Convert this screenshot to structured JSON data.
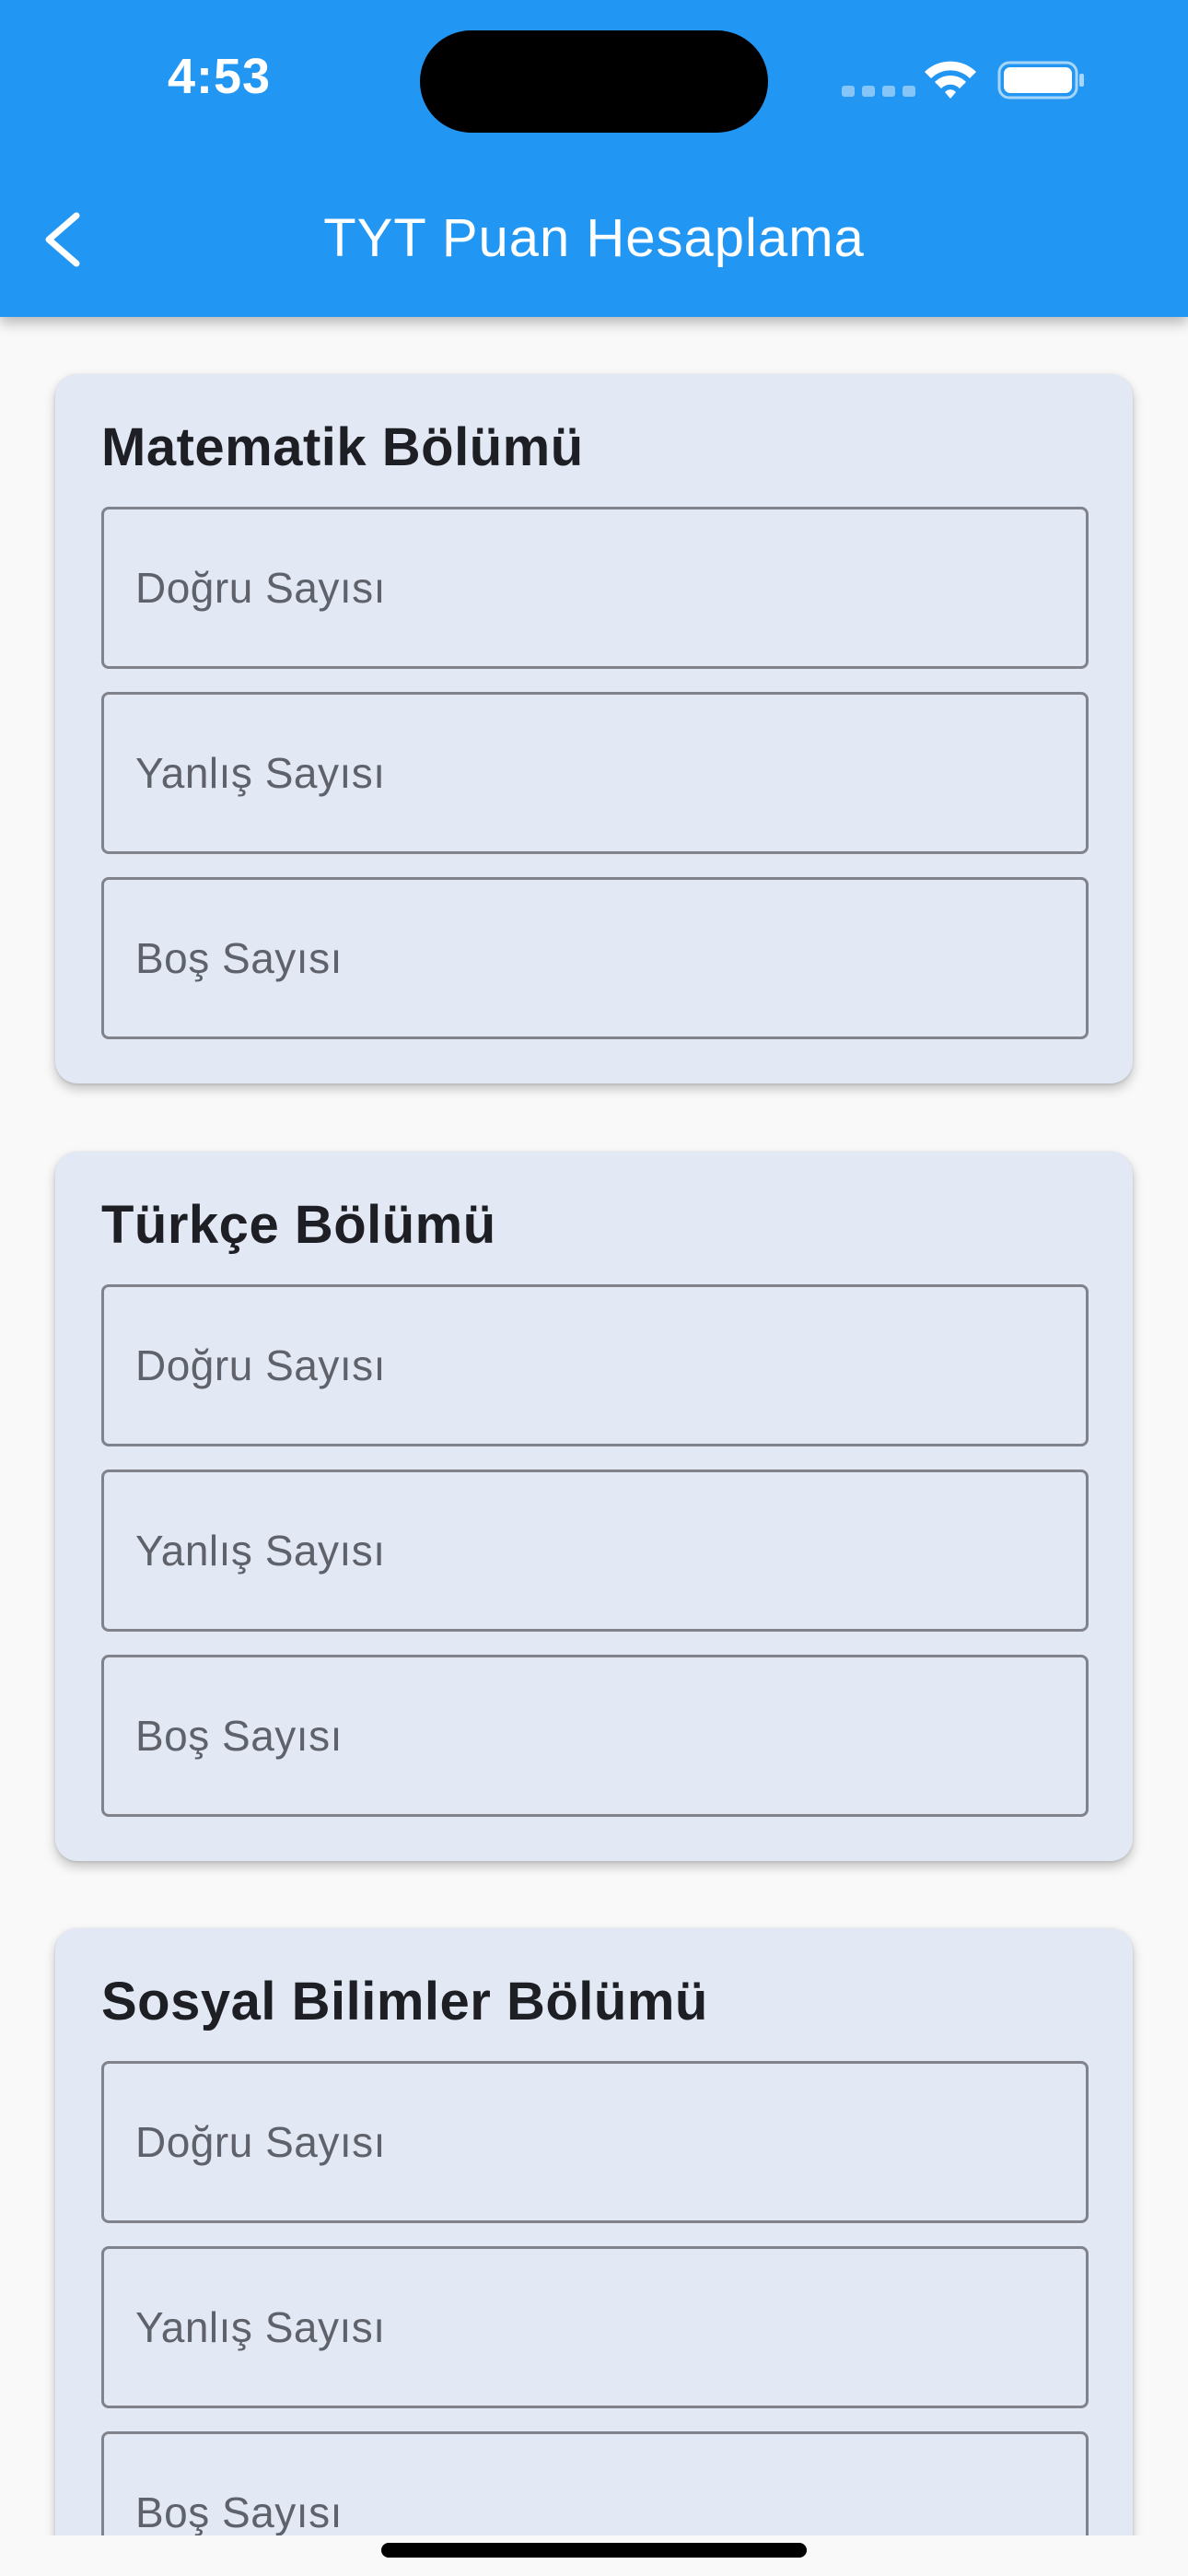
{
  "status_bar": {
    "time": "4:53",
    "icons": [
      "cellular-signal-icon",
      "wifi-icon",
      "battery-icon"
    ]
  },
  "app_bar": {
    "title": "TYT Puan Hesaplama",
    "back_icon": "chevron-left-icon",
    "background_color": "#2196f3"
  },
  "sections": [
    {
      "title": "Matematik Bölümü",
      "fields": [
        {
          "label": "Doğru Sayısı",
          "value": ""
        },
        {
          "label": "Yanlış Sayısı",
          "value": ""
        },
        {
          "label": "Boş Sayısı",
          "value": ""
        }
      ]
    },
    {
      "title": "Türkçe Bölümü",
      "fields": [
        {
          "label": "Doğru Sayısı",
          "value": ""
        },
        {
          "label": "Yanlış Sayısı",
          "value": ""
        },
        {
          "label": "Boş Sayısı",
          "value": ""
        }
      ]
    },
    {
      "title": "Sosyal Bilimler Bölümü",
      "fields": [
        {
          "label": "Doğru Sayısı",
          "value": ""
        },
        {
          "label": "Yanlış Sayısı",
          "value": ""
        },
        {
          "label": "Boş Sayısı",
          "value": ""
        }
      ]
    }
  ],
  "colors": {
    "card_background": "#e2e8f4",
    "page_background": "#f9f9f9",
    "field_border": "#80838c",
    "title_text": "#1e1f24",
    "label_text": "#5f626a"
  }
}
